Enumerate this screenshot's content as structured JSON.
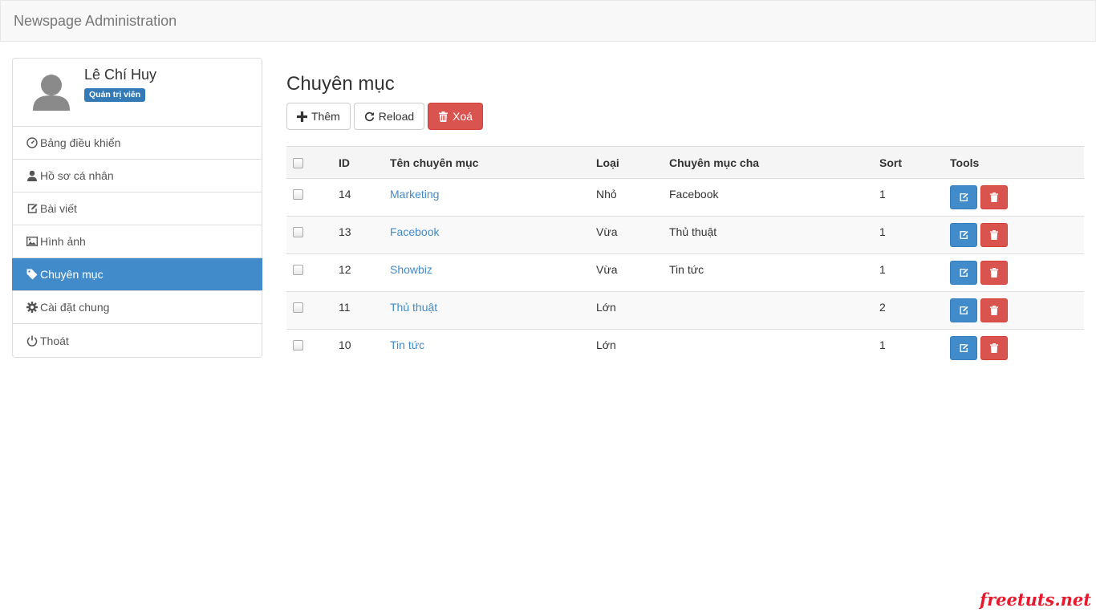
{
  "app": {
    "title": "Newspage Administration"
  },
  "user": {
    "name": "Lê Chí Huy",
    "role": "Quản trị viên"
  },
  "sidebar": {
    "items": [
      {
        "label": "Bảng điều khiển",
        "icon": "dashboard-icon",
        "active": false
      },
      {
        "label": "Hồ sơ cá nhân",
        "icon": "user-icon",
        "active": false
      },
      {
        "label": "Bài viết",
        "icon": "edit-icon",
        "active": false
      },
      {
        "label": "Hình ảnh",
        "icon": "image-icon",
        "active": false
      },
      {
        "label": "Chuyên mục",
        "icon": "tag-icon",
        "active": true
      },
      {
        "label": "Cài đặt chung",
        "icon": "gear-icon",
        "active": false
      },
      {
        "label": "Thoát",
        "icon": "power-icon",
        "active": false
      }
    ]
  },
  "main": {
    "title": "Chuyên mục",
    "toolbar": {
      "add_label": "Thêm",
      "reload_label": "Reload",
      "delete_label": "Xoá"
    },
    "table": {
      "headers": {
        "id": "ID",
        "name": "Tên chuyên mục",
        "type": "Loại",
        "parent": "Chuyên mục cha",
        "sort": "Sort",
        "tools": "Tools"
      },
      "rows": [
        {
          "id": "14",
          "name": "Marketing",
          "type": "Nhỏ",
          "parent": "Facebook",
          "sort": "1"
        },
        {
          "id": "13",
          "name": "Facebook",
          "type": "Vừa",
          "parent": "Thủ thuật",
          "sort": "1"
        },
        {
          "id": "12",
          "name": "Showbiz",
          "type": "Vừa",
          "parent": "Tin tức",
          "sort": "1"
        },
        {
          "id": "11",
          "name": "Thủ thuật",
          "type": "Lớn",
          "parent": "",
          "sort": "2"
        },
        {
          "id": "10",
          "name": "Tin tức",
          "type": "Lớn",
          "parent": "",
          "sort": "1"
        }
      ]
    }
  },
  "watermark": "freetuts.net",
  "colors": {
    "primary": "#428bca",
    "danger": "#d9534f",
    "badge": "#337ab7",
    "watermark": "#e8192c"
  }
}
